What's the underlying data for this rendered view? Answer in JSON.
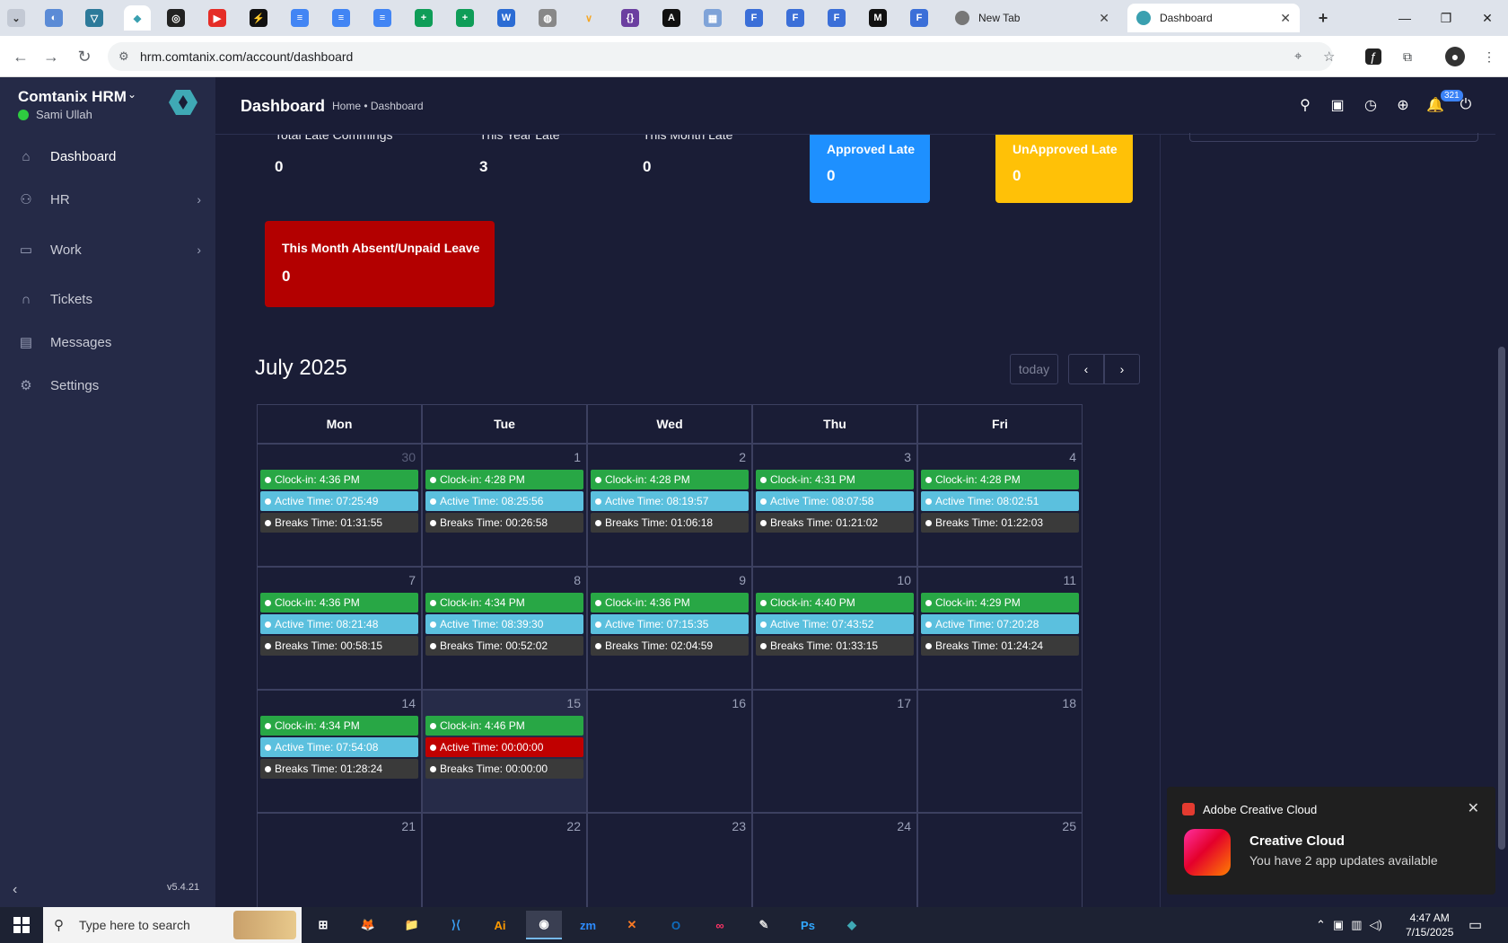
{
  "browser": {
    "tabs": [
      {
        "name": "tab-newtab",
        "title": "New Tab"
      },
      {
        "name": "tab-dashboard",
        "title": "Dashboard"
      }
    ],
    "url": "hrm.comtanix.com/account/dashboard"
  },
  "sidebar": {
    "brand": "Comtanix HRM",
    "user": "Sami Ullah",
    "items": [
      {
        "label": "Dashboard",
        "icon": "home-icon"
      },
      {
        "label": "HR",
        "icon": "users-icon"
      },
      {
        "label": "Work",
        "icon": "briefcase-icon"
      },
      {
        "label": "Tickets",
        "icon": "headset-icon"
      },
      {
        "label": "Messages",
        "icon": "message-icon"
      },
      {
        "label": "Settings",
        "icon": "gear-icon"
      }
    ],
    "version": "v5.4.21"
  },
  "header": {
    "title": "Dashboard",
    "breadcrumb": "Home • Dashboard",
    "notifications": "321"
  },
  "stats": [
    {
      "label": "Total Late Commings",
      "value": "0"
    },
    {
      "label": "This Year Late",
      "value": "3"
    },
    {
      "label": "This Month Late",
      "value": "0"
    }
  ],
  "cards": [
    {
      "label": "Approved Late",
      "value": "0",
      "color": "#1e90ff"
    },
    {
      "label": "UnApproved Late",
      "value": "0",
      "color": "#ffc107"
    },
    {
      "label": "This Month Absent/Unpaid Leave",
      "value": "0",
      "color": "#b30000"
    }
  ],
  "calendar": {
    "title": "July 2025",
    "today": "today",
    "days": [
      "Mon",
      "Tue",
      "Wed",
      "Thu",
      "Fri"
    ],
    "colors": {
      "clockin": "#28a745",
      "active": "#5bc0de",
      "breaks": "#3a3a3a",
      "alert": "#c00000"
    },
    "weeks": [
      [
        {
          "d": "30",
          "other": true,
          "events": [
            {
              "t": "Clock-in: 4:36 PM",
              "k": "clockin"
            },
            {
              "t": "Active Time: 07:25:49",
              "k": "active"
            },
            {
              "t": "Breaks Time: 01:31:55",
              "k": "breaks"
            }
          ]
        },
        {
          "d": "1",
          "events": [
            {
              "t": "Clock-in: 4:28 PM",
              "k": "clockin"
            },
            {
              "t": "Active Time: 08:25:56",
              "k": "active"
            },
            {
              "t": "Breaks Time: 00:26:58",
              "k": "breaks"
            }
          ]
        },
        {
          "d": "2",
          "events": [
            {
              "t": "Clock-in: 4:28 PM",
              "k": "clockin"
            },
            {
              "t": "Active Time: 08:19:57",
              "k": "active"
            },
            {
              "t": "Breaks Time: 01:06:18",
              "k": "breaks"
            }
          ]
        },
        {
          "d": "3",
          "events": [
            {
              "t": "Clock-in: 4:31 PM",
              "k": "clockin"
            },
            {
              "t": "Active Time: 08:07:58",
              "k": "active"
            },
            {
              "t": "Breaks Time: 01:21:02",
              "k": "breaks"
            }
          ]
        },
        {
          "d": "4",
          "events": [
            {
              "t": "Clock-in: 4:28 PM",
              "k": "clockin"
            },
            {
              "t": "Active Time: 08:02:51",
              "k": "active"
            },
            {
              "t": "Breaks Time: 01:22:03",
              "k": "breaks"
            }
          ]
        }
      ],
      [
        {
          "d": "7",
          "events": [
            {
              "t": "Clock-in: 4:36 PM",
              "k": "clockin"
            },
            {
              "t": "Active Time: 08:21:48",
              "k": "active"
            },
            {
              "t": "Breaks Time: 00:58:15",
              "k": "breaks"
            }
          ]
        },
        {
          "d": "8",
          "events": [
            {
              "t": "Clock-in: 4:34 PM",
              "k": "clockin"
            },
            {
              "t": "Active Time: 08:39:30",
              "k": "active"
            },
            {
              "t": "Breaks Time: 00:52:02",
              "k": "breaks"
            }
          ]
        },
        {
          "d": "9",
          "events": [
            {
              "t": "Clock-in: 4:36 PM",
              "k": "clockin"
            },
            {
              "t": "Active Time: 07:15:35",
              "k": "active"
            },
            {
              "t": "Breaks Time: 02:04:59",
              "k": "breaks"
            }
          ]
        },
        {
          "d": "10",
          "events": [
            {
              "t": "Clock-in: 4:40 PM",
              "k": "clockin"
            },
            {
              "t": "Active Time: 07:43:52",
              "k": "active"
            },
            {
              "t": "Breaks Time: 01:33:15",
              "k": "breaks"
            }
          ]
        },
        {
          "d": "11",
          "events": [
            {
              "t": "Clock-in: 4:29 PM",
              "k": "clockin"
            },
            {
              "t": "Active Time: 07:20:28",
              "k": "active"
            },
            {
              "t": "Breaks Time: 01:24:24",
              "k": "breaks"
            }
          ]
        }
      ],
      [
        {
          "d": "14",
          "events": [
            {
              "t": "Clock-in: 4:34 PM",
              "k": "clockin"
            },
            {
              "t": "Active Time: 07:54:08",
              "k": "active"
            },
            {
              "t": "Breaks Time: 01:28:24",
              "k": "breaks"
            }
          ]
        },
        {
          "d": "15",
          "today": true,
          "events": [
            {
              "t": "Clock-in: 4:46 PM",
              "k": "clockin"
            },
            {
              "t": "Active Time: 00:00:00",
              "k": "alert"
            },
            {
              "t": "Breaks Time: 00:00:00",
              "k": "breaks"
            }
          ]
        },
        {
          "d": "16",
          "events": []
        },
        {
          "d": "17",
          "events": []
        },
        {
          "d": "18",
          "events": []
        }
      ],
      [
        {
          "d": "21",
          "events": []
        },
        {
          "d": "22",
          "events": []
        },
        {
          "d": "23",
          "events": []
        },
        {
          "d": "24",
          "events": []
        },
        {
          "d": "25",
          "events": []
        }
      ]
    ]
  },
  "toast": {
    "app": "Adobe Creative Cloud",
    "title": "Creative Cloud",
    "message": "You have 2 app updates available"
  },
  "taskbar": {
    "search_placeholder": "Type here to search",
    "time": "4:47 AM",
    "date": "7/15/2025",
    "apps": [
      {
        "icon": "task-view-icon",
        "label": "⊞"
      },
      {
        "icon": "firefox-icon",
        "label": "🦊"
      },
      {
        "icon": "file-explorer-icon",
        "label": "📁"
      },
      {
        "icon": "vscode-icon",
        "label": "⟩⟨"
      },
      {
        "icon": "illustrator-icon",
        "label": "Ai"
      },
      {
        "icon": "chrome-icon",
        "label": "◉"
      },
      {
        "icon": "zoom-icon",
        "label": "zm"
      },
      {
        "icon": "xampp-icon",
        "label": "✕"
      },
      {
        "icon": "outlook-icon",
        "label": "O"
      },
      {
        "icon": "creative-cloud-icon",
        "label": "∞"
      },
      {
        "icon": "pen-icon",
        "label": "✎"
      },
      {
        "icon": "photoshop-icon",
        "label": "Ps"
      },
      {
        "icon": "hrm-app-icon",
        "label": "◆"
      }
    ]
  }
}
